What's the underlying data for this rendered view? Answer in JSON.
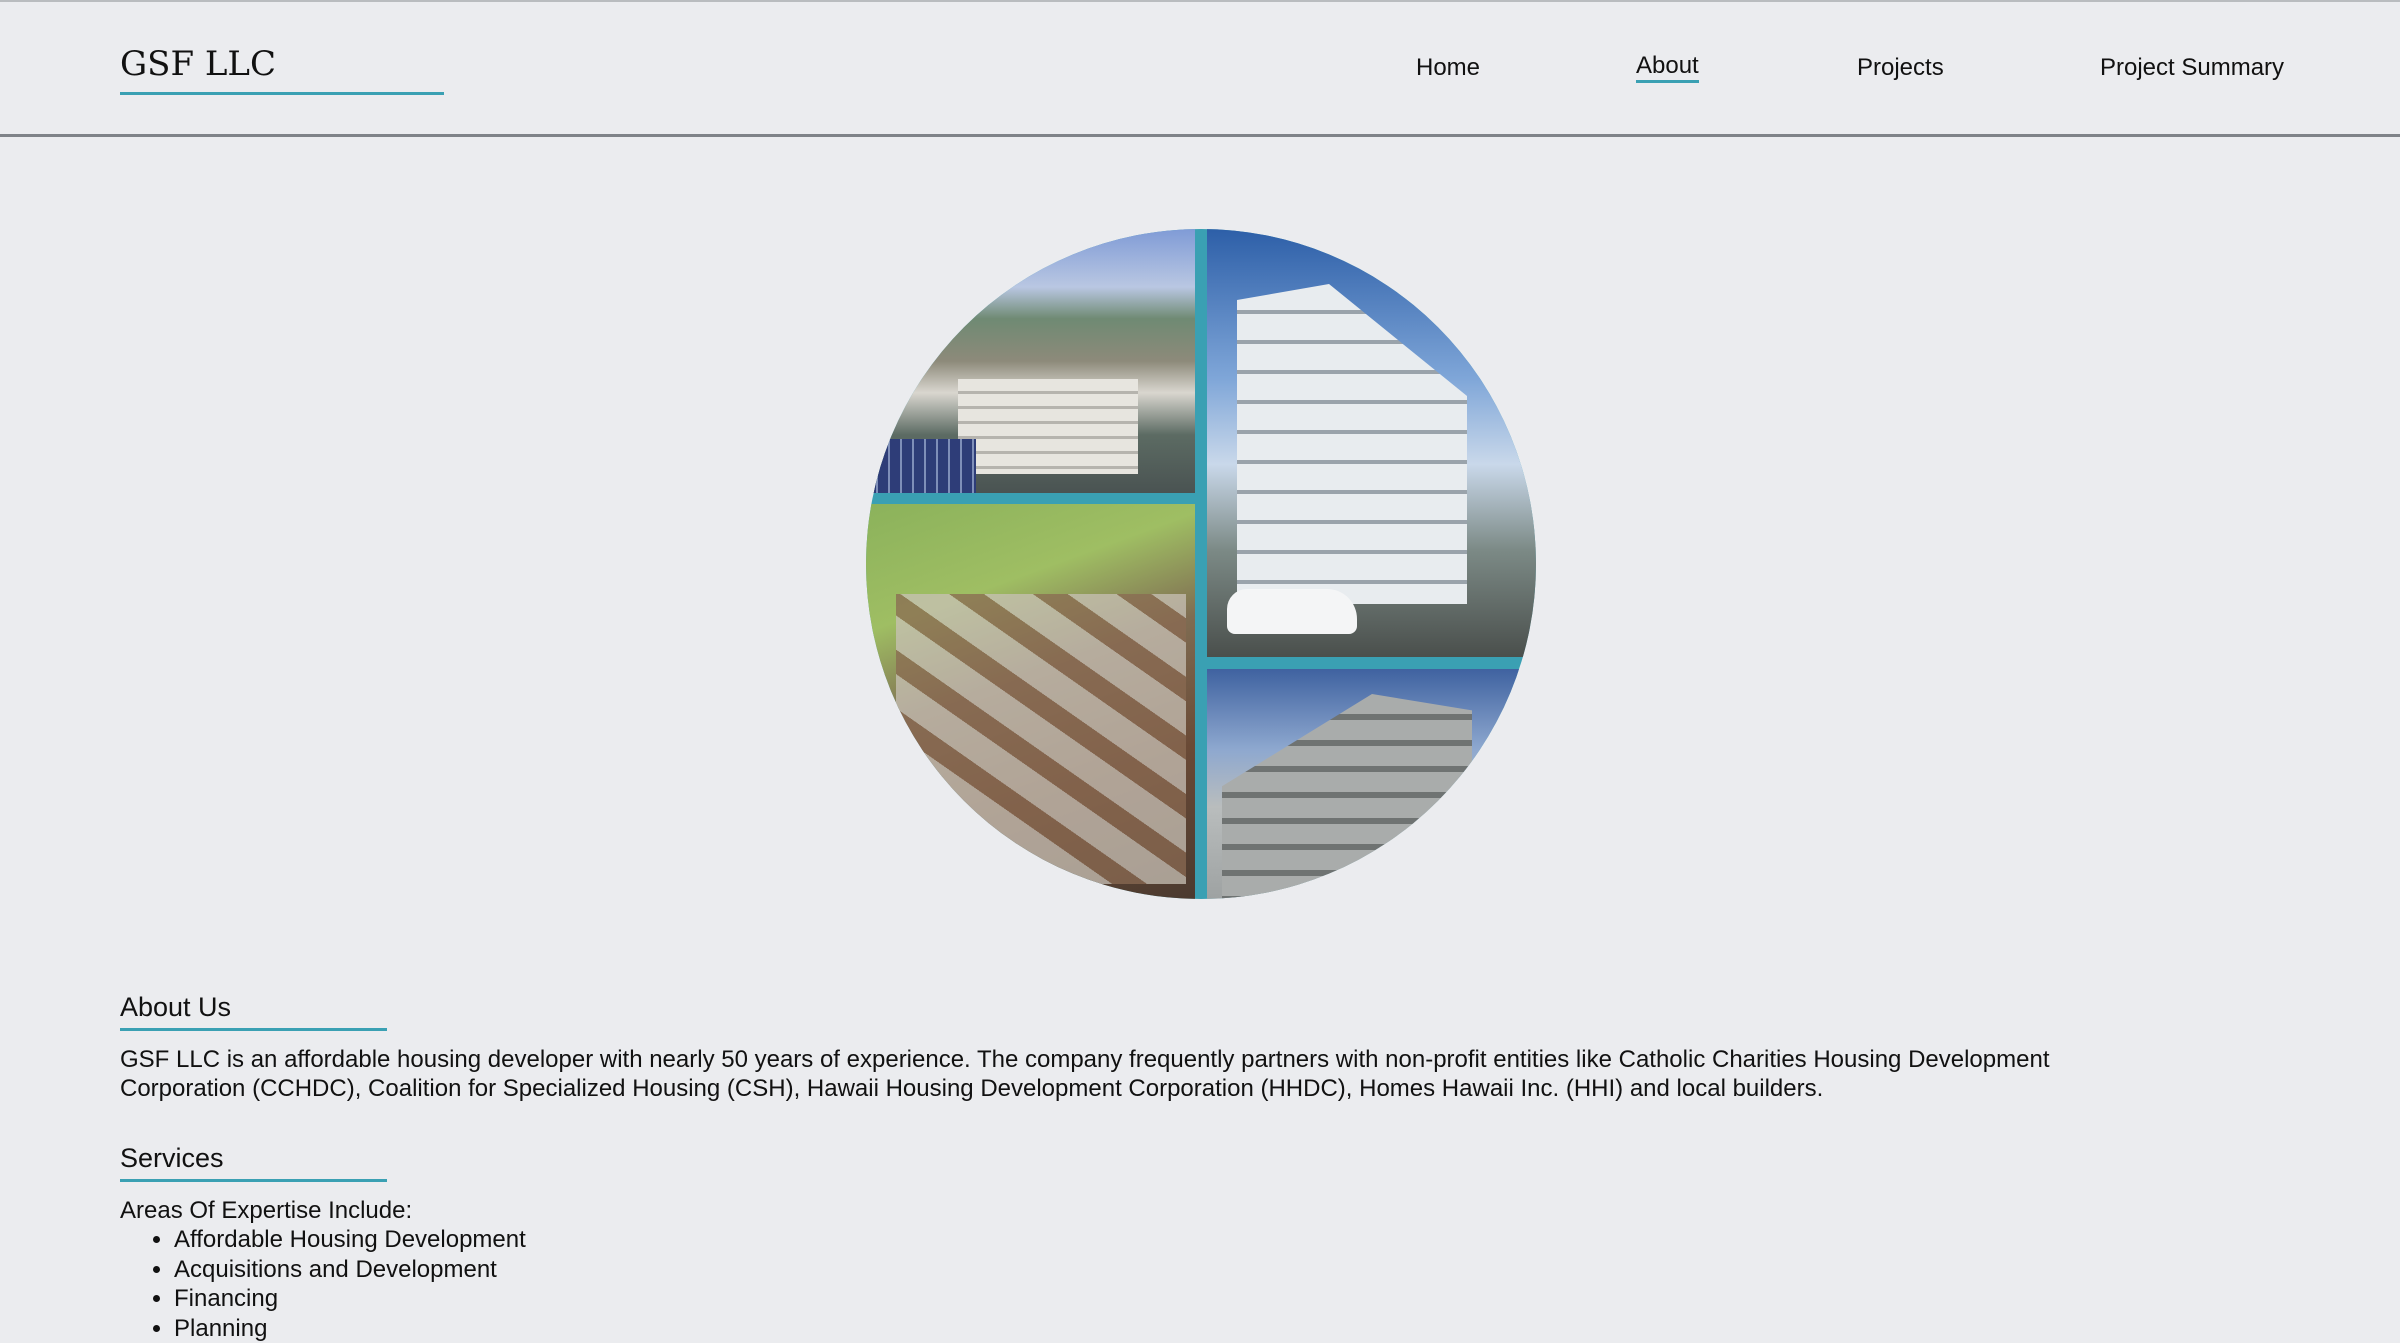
{
  "header": {
    "brand": "GSF LLC",
    "nav": [
      {
        "label": "Home",
        "active": false
      },
      {
        "label": "About",
        "active": true
      },
      {
        "label": "Projects",
        "active": false
      },
      {
        "label": "Project Summary",
        "active": false
      }
    ]
  },
  "about": {
    "heading": "About Us",
    "text": "GSF LLC is an affordable housing developer with nearly 50 years of experience. The company frequently partners with non-profit entities like Catholic Charities Housing Development Corporation (CCHDC), Coalition for Specialized Housing (CSH), Hawaii Housing Development Corporation (HHDC), Homes Hawaii Inc. (HHI) and local builders."
  },
  "services": {
    "heading": "Services",
    "intro": "Areas Of Expertise Include:",
    "items": [
      "Affordable Housing Development",
      "Acquisitions and Development",
      "Financing",
      "Planning"
    ]
  },
  "colors": {
    "accent": "#3aa0b3",
    "background": "#ebecef"
  }
}
